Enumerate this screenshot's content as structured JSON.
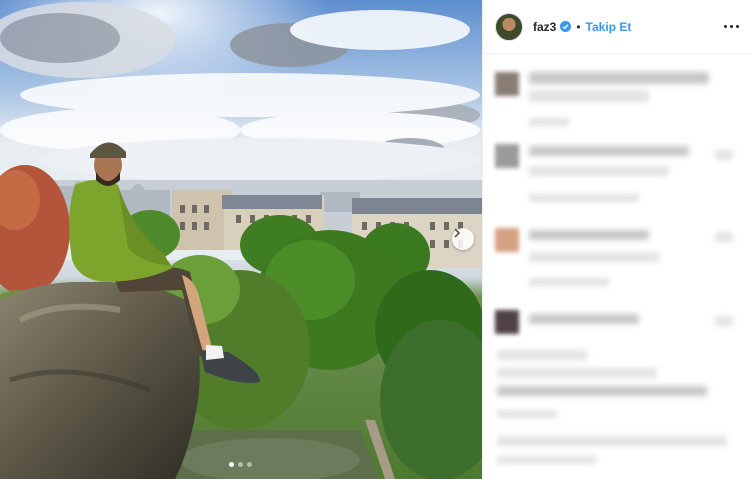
{
  "post": {
    "image_alt": "",
    "carousel": {
      "current": 1,
      "total": 3
    }
  },
  "header": {
    "username": "faz3",
    "separator": "•",
    "follow_label": "Takip Et"
  },
  "colors": {
    "accent": "#3897f0",
    "text": "#262626",
    "border": "#efefef"
  },
  "icons": {
    "verified": "verified-badge-icon",
    "more": "more-options-icon",
    "next": "chevron-right-icon"
  }
}
